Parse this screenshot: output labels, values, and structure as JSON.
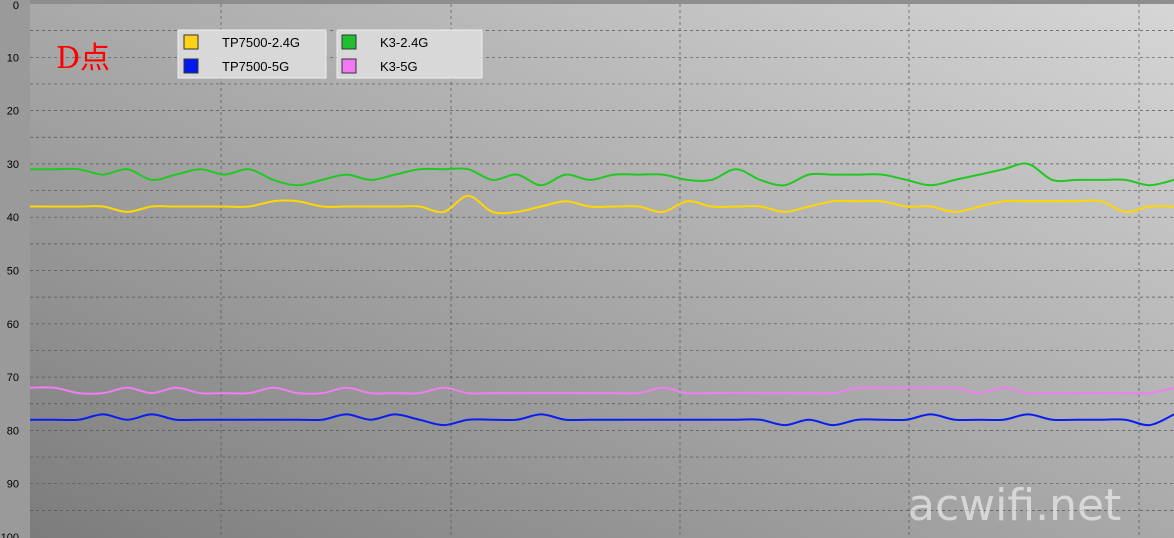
{
  "chart_data": {
    "type": "line",
    "title": "D点",
    "watermark": "acwifi.net",
    "ylim": [
      0,
      100
    ],
    "y_inverted": true,
    "y_ticks": [
      0,
      10,
      20,
      30,
      40,
      50,
      60,
      70,
      80,
      90,
      100
    ],
    "grid": true,
    "legend_position": "top-left",
    "x": [
      0,
      1,
      2,
      3,
      4,
      5,
      6,
      7,
      8,
      9,
      10,
      11,
      12,
      13,
      14,
      15,
      16,
      17,
      18,
      19,
      20,
      21,
      22,
      23,
      24,
      25,
      26,
      27,
      28,
      29,
      30,
      31,
      32,
      33,
      34,
      35,
      36,
      37,
      38,
      39,
      40,
      41,
      42,
      43,
      44,
      45,
      46,
      47
    ],
    "series": [
      {
        "name": "TP7500-2.4G",
        "color": "#ffd700",
        "swatch": "#ffd21a",
        "values": [
          38,
          38,
          38,
          38,
          39,
          38,
          38,
          38,
          38,
          38,
          37,
          37,
          38,
          38,
          38,
          38,
          38,
          39,
          36,
          39,
          39,
          38,
          37,
          38,
          38,
          38,
          39,
          37,
          38,
          38,
          38,
          39,
          38,
          37,
          37,
          37,
          38,
          38,
          39,
          38,
          37,
          37,
          37,
          37,
          37,
          39,
          38,
          38
        ]
      },
      {
        "name": "TP7500-5G",
        "color": "#0a1ef0",
        "swatch": "#0018f0",
        "values": [
          78,
          78,
          78,
          77,
          78,
          77,
          78,
          78,
          78,
          78,
          78,
          78,
          78,
          77,
          78,
          77,
          78,
          79,
          78,
          78,
          78,
          77,
          78,
          78,
          78,
          78,
          78,
          78,
          78,
          78,
          78,
          79,
          78,
          79,
          78,
          78,
          78,
          77,
          78,
          78,
          78,
          77,
          78,
          78,
          78,
          78,
          79,
          77
        ]
      },
      {
        "name": "K3-2.4G",
        "color": "#22c822",
        "swatch": "#1fbf30",
        "values": [
          31,
          31,
          31,
          32,
          31,
          33,
          32,
          31,
          32,
          31,
          33,
          34,
          33,
          32,
          33,
          32,
          31,
          31,
          31,
          33,
          32,
          34,
          32,
          33,
          32,
          32,
          32,
          33,
          33,
          31,
          33,
          34,
          32,
          32,
          32,
          32,
          33,
          34,
          33,
          32,
          31,
          30,
          33,
          33,
          33,
          33,
          34,
          33
        ]
      },
      {
        "name": "K3-5G",
        "color": "#f07ef0",
        "swatch": "#f078f0",
        "values": [
          72,
          72,
          73,
          73,
          72,
          73,
          72,
          73,
          73,
          73,
          72,
          73,
          73,
          72,
          73,
          73,
          73,
          72,
          73,
          73,
          73,
          73,
          73,
          73,
          73,
          73,
          72,
          73,
          73,
          73,
          73,
          73,
          73,
          73,
          72,
          72,
          72,
          72,
          72,
          73,
          72,
          73,
          73,
          73,
          73,
          73,
          73,
          72
        ]
      }
    ]
  }
}
